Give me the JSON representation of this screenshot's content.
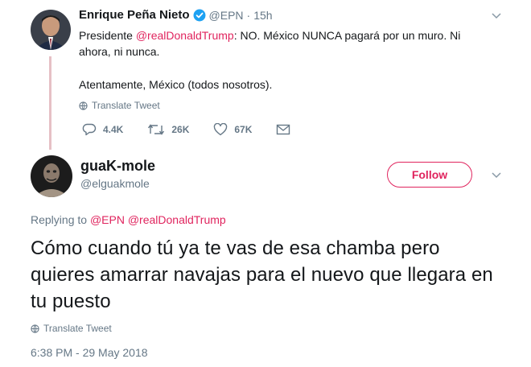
{
  "parent_tweet": {
    "display_name": "Enrique Peña Nieto",
    "handle": "@EPN",
    "separator": "·",
    "time": "15h",
    "text_prefix": "Presidente ",
    "mention": "@realDonaldTrump",
    "text_suffix": ": NO. México NUNCA pagará por un muro. Ni ahora, ni nunca.",
    "text_line2": "Atentamente, México (todos nosotros).",
    "translate_label": "Translate Tweet",
    "replies": "4.4K",
    "retweets": "26K",
    "likes": "67K"
  },
  "reply_tweet": {
    "display_name": "guaK-mole",
    "handle": "@elguakmole",
    "follow_label": "Follow",
    "replying_to_label": "Replying to",
    "replying_to_users": "@EPN @realDonaldTrump",
    "text": "Cómo cuando tú ya te vas de esa chamba pero quieres amarrar navajas para el nuevo que llegara en tu puesto",
    "translate_label": "Translate Tweet",
    "timestamp": "6:38 PM - 29 May 2018"
  },
  "colors": {
    "accent": "#e0245e",
    "verified": "#1da1f2",
    "muted": "#657786",
    "thread_line": "#e6c0c5"
  },
  "icons": [
    "verified-badge-icon",
    "chevron-down-icon",
    "globe-icon",
    "reply-icon",
    "retweet-icon",
    "like-icon",
    "message-icon"
  ]
}
